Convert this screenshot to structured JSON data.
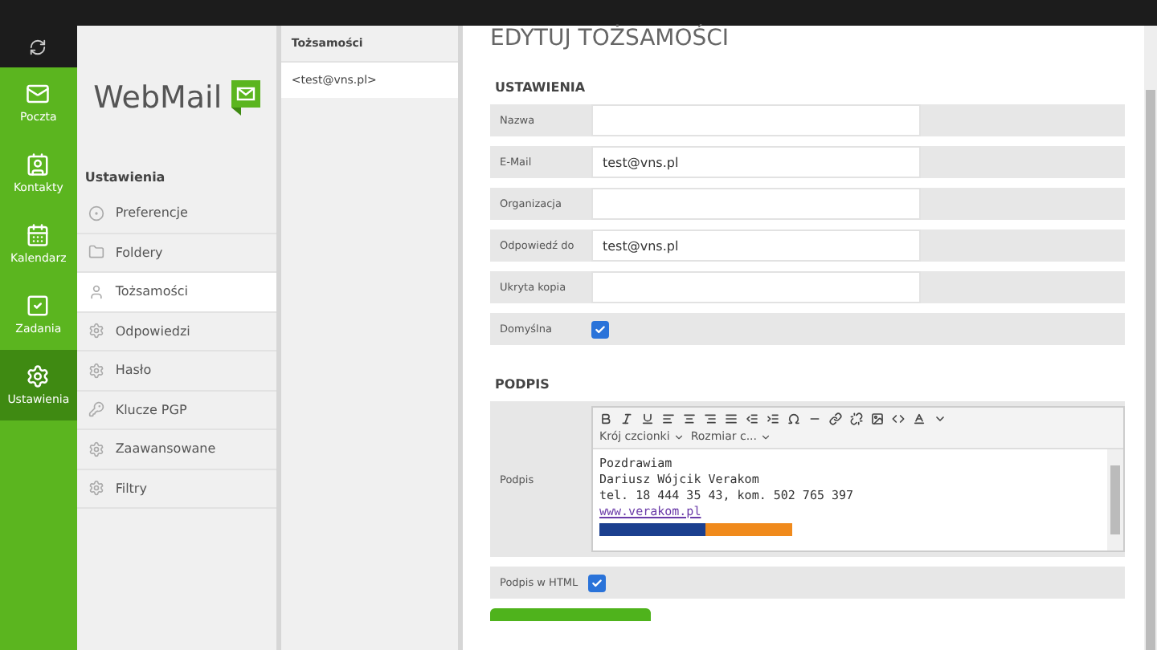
{
  "nav": [
    {
      "label": "Poczta",
      "selected": false
    },
    {
      "label": "Kontakty",
      "selected": false
    },
    {
      "label": "Kalendarz",
      "selected": false
    },
    {
      "label": "Zadania",
      "selected": false
    },
    {
      "label": "Ustawienia",
      "selected": true
    }
  ],
  "logo": {
    "text": "WebMail"
  },
  "settings": {
    "title": "Ustawienia",
    "items": [
      {
        "label": "Preferencje",
        "selected": false
      },
      {
        "label": "Foldery",
        "selected": false
      },
      {
        "label": "Tożsamości",
        "selected": true
      },
      {
        "label": "Odpowiedzi",
        "selected": false
      },
      {
        "label": "Hasło",
        "selected": false
      },
      {
        "label": "Klucze PGP",
        "selected": false
      },
      {
        "label": "Zaawansowane",
        "selected": false
      },
      {
        "label": "Filtry",
        "selected": false
      }
    ]
  },
  "identities": {
    "title": "Tożsamości",
    "items": [
      {
        "label": "<test@vns.pl>",
        "selected": true
      }
    ]
  },
  "editor": {
    "title": "EDYTUJ TOŻSAMOŚCI",
    "section": "USTAWIENIA",
    "fields": [
      {
        "label": "Nazwa",
        "kind": "text"
      },
      {
        "label": "E-Mail",
        "kind": "text",
        "value": "test@vns.pl"
      },
      {
        "label": "Organizacja",
        "kind": "text"
      },
      {
        "label": "Odpowiedź do",
        "kind": "text",
        "value": "test@vns.pl"
      },
      {
        "label": "Ukryta kopia",
        "kind": "text"
      },
      {
        "label": "Domyślna",
        "kind": "checkbox",
        "checked": true
      }
    ],
    "signature": {
      "title": "PODPIS",
      "label": "Podpis",
      "font_dropdown": "Krój czcionki",
      "size_dropdown": "Rozmiar c...",
      "lines": [
        "Pozdrawiam",
        "Dariusz Wójcik Verakom",
        "tel. 18 444 35 43, kom. 502 765 397"
      ],
      "link": "www.verakom.pl"
    },
    "html_option": {
      "label": "Podpis w HTML",
      "checked": true
    }
  }
}
